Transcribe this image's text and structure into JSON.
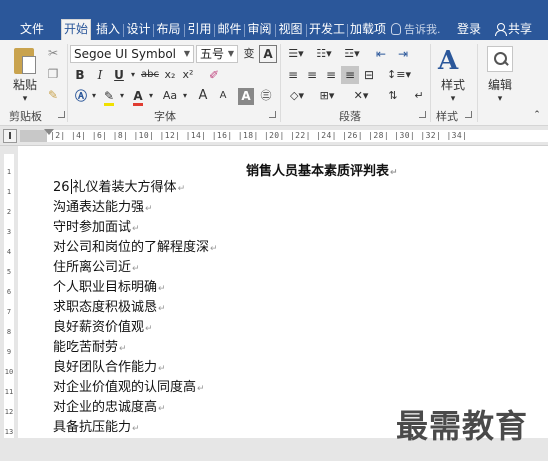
{
  "tabs": {
    "file": "文件",
    "home": "开始",
    "insert": "插入",
    "design": "设计",
    "layout": "布局",
    "references": "引用",
    "mailings": "邮件",
    "review": "审阅",
    "view": "视图",
    "developer": "开发工",
    "addins": "加载项",
    "tellme": "告诉我.",
    "login": "登录",
    "share": "共享"
  },
  "ribbon": {
    "clipboard": {
      "paste": "粘贴",
      "label": "剪贴板"
    },
    "font": {
      "name": "Segoe UI Symbol",
      "size": "五号",
      "phonetic": "wén",
      "bold": "B",
      "italic": "I",
      "underline": "U",
      "strike": "abc",
      "subscript": "x₂",
      "superscript": "x²",
      "font_color": "A",
      "change_case": "Aa",
      "grow": "A",
      "shrink": "A",
      "label": "字体"
    },
    "paragraph": {
      "label": "段落"
    },
    "styles": {
      "name": "样式",
      "label": "样式"
    },
    "editing": {
      "name": "编辑"
    }
  },
  "ruler": {
    "ticks": "|2|  |4|  |6|  |8|  |10|  |12|  |14|  |16|  |18|  |20|  |22|  |24|  |26|  |28|  |30|  |32|  |34|"
  },
  "vruler": {
    "marks": [
      "1",
      "1",
      "2",
      "3",
      "4",
      "5",
      "6",
      "7",
      "8",
      "9",
      "10",
      "11",
      "12",
      "13",
      "14"
    ]
  },
  "document": {
    "title": "销售人员基本素质评判表",
    "paragraph_mark": "↵",
    "first_prefix": "26",
    "lines": [
      "礼仪着装大方得体",
      "沟通表达能力强",
      "守时参加面试",
      "对公司和岗位的了解程度深",
      "住所离公司近",
      "个人职业目标明确",
      "求职态度积极诚恳",
      "良好薪资价值观",
      "能吃苦耐劳",
      "良好团队合作能力",
      "对企业价值观的认同度高",
      "对企业的忠诚度高",
      "具备抗压能力"
    ]
  },
  "watermark": "最需教育",
  "colors": {
    "brand": "#2b579a",
    "ribbon_bg": "#f3f3f3",
    "font_color_red": "#e03c31",
    "highlight": "#f0e000"
  }
}
